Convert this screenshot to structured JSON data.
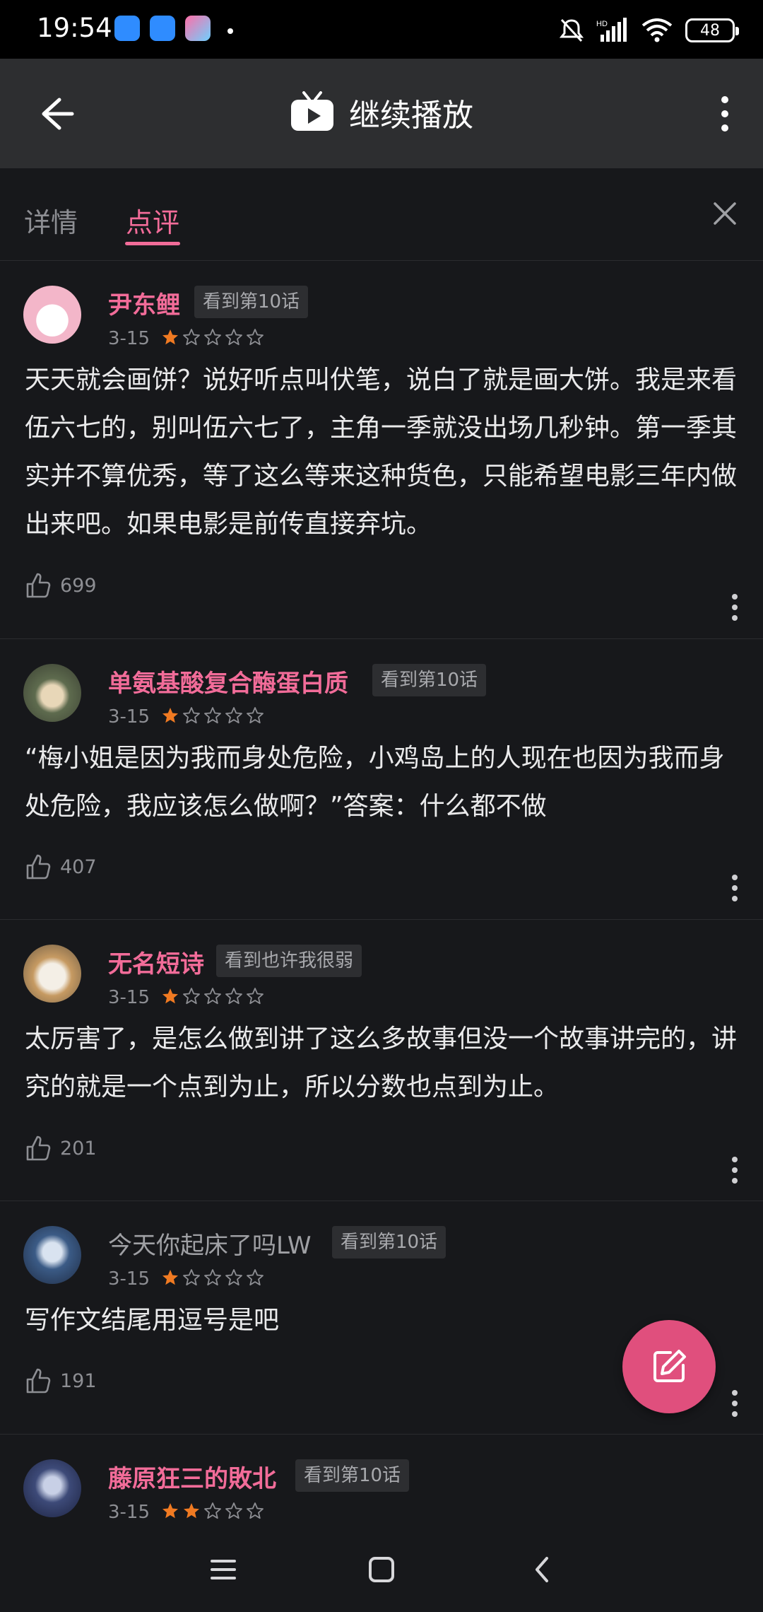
{
  "status_bar": {
    "time": "19:54",
    "battery": "48",
    "icons": [
      "bell-muted-icon",
      "hd-signal-icon",
      "wifi-icon",
      "battery-icon"
    ]
  },
  "top_bar": {
    "title": "继续播放",
    "icons": [
      "back-arrow-icon",
      "tv-icon",
      "more-vertical-icon"
    ]
  },
  "tabs": [
    {
      "label": "详情",
      "active": false
    },
    {
      "label": "点评",
      "active": true
    }
  ],
  "accent_color": "#f26c99",
  "comments": [
    {
      "name": "尹东鲤",
      "name_style": "pink",
      "badge": "看到第10话",
      "date": "3-15",
      "rating": 1,
      "text": "天天就会画饼？说好听点叫伏笔，说白了就是画大饼。我是来看伍六七的，别叫伍六七了，主角一季就没出场几秒钟。第一季其实并不算优秀，等了这么等来这种货色，只能希望电影三年内做出来吧。如果电影是前传直接弃坑。",
      "likes": "699"
    },
    {
      "name": "单氨基酸复合酶蛋白质",
      "name_style": "pink",
      "badge": "看到第10话",
      "date": "3-15",
      "rating": 1,
      "text": "“梅小姐是因为我而身处危险，小鸡岛上的人现在也因为我而身处危险，我应该怎么做啊？”答案：什么都不做",
      "likes": "407"
    },
    {
      "name": "无名短诗",
      "name_style": "pink",
      "badge": "看到也许我很弱",
      "date": "3-15",
      "rating": 1,
      "text": "太厉害了，是怎么做到讲了这么多故事但没一个故事讲完的，讲究的就是一个点到为止，所以分数也点到为止。",
      "likes": "201"
    },
    {
      "name": "今天你起床了吗LW",
      "name_style": "plain",
      "badge": "看到第10话",
      "date": "3-15",
      "rating": 1,
      "text": "写作文结尾用逗号是吧",
      "likes": "191"
    },
    {
      "name": "藤原狂三的敗北",
      "name_style": "pink",
      "badge": "看到第10话",
      "date": "3-15",
      "rating": 2,
      "text": "",
      "likes": ""
    }
  ],
  "fab_icon": "edit-icon",
  "nav_bar_icons": [
    "menu-icon",
    "home-square-icon",
    "back-chevron-icon"
  ]
}
